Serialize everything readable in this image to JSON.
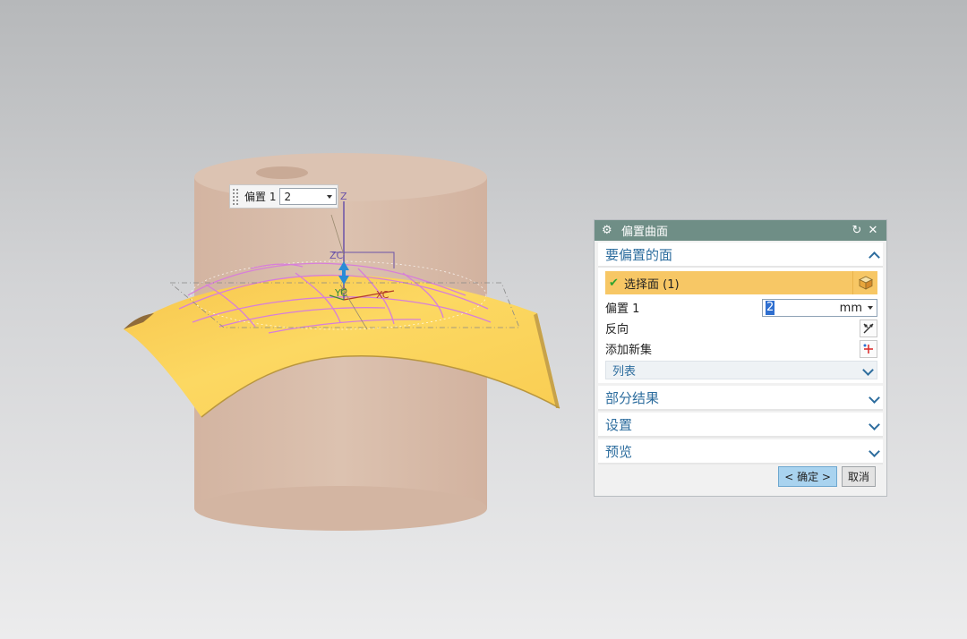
{
  "viewport": {
    "float_label": "偏置 1",
    "float_value": "2",
    "axis": {
      "z": "Z",
      "zc": "ZC",
      "yc": "YC",
      "xc": "XC"
    }
  },
  "dialog": {
    "title": "偏置曲面",
    "section_faces": {
      "title": "要偏置的面",
      "select_label": "选择面 (1)",
      "offset_label": "偏置 1",
      "offset_value": "2",
      "offset_unit": "mm",
      "reverse_label": "反向",
      "add_set_label": "添加新集",
      "list_label": "列表"
    },
    "section_partial": "部分结果",
    "section_settings": "设置",
    "section_preview": "预览",
    "ok_label": "< 确定 >",
    "cancel_label": "取消"
  },
  "colors": {
    "title_bar": "#6f8e86",
    "section_text": "#2d6d9e",
    "selection_highlight": "#f7c765",
    "cylinder": "#d8bca8",
    "surface": "#fbd45a",
    "curves": "#d77fd9"
  }
}
